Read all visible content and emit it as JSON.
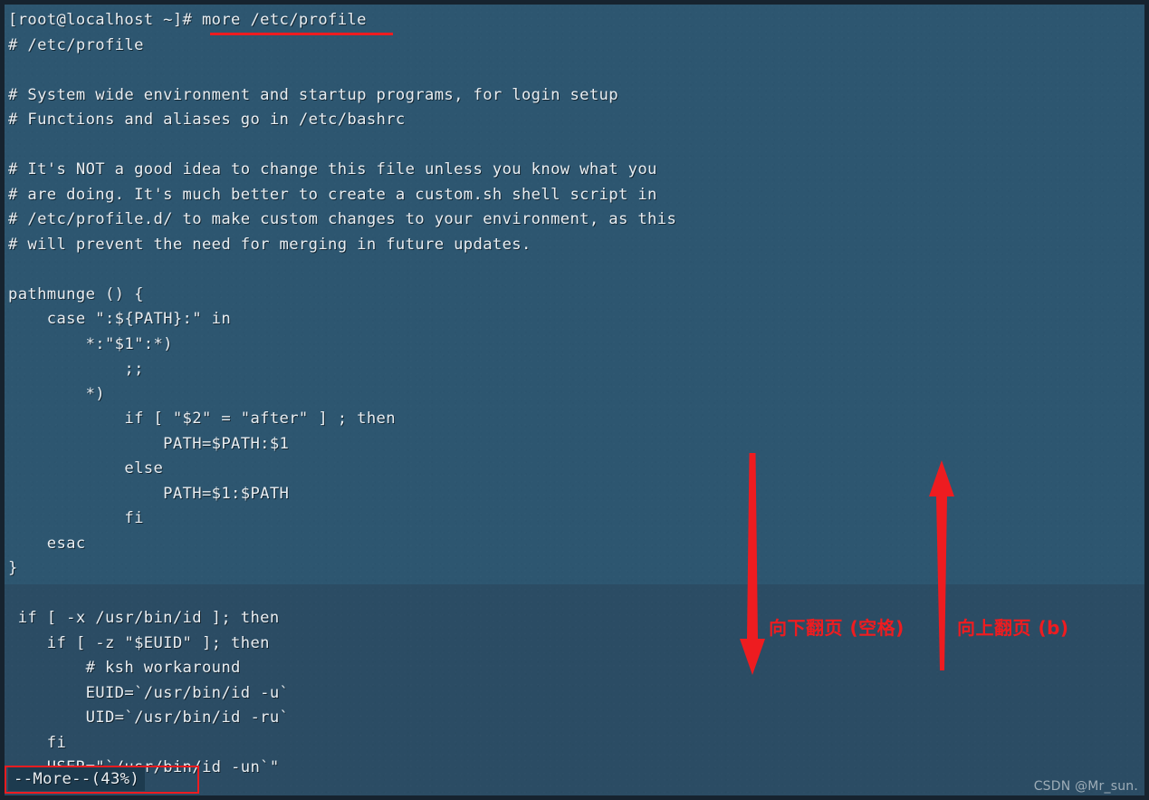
{
  "terminal": {
    "prompt_line": "[root@localhost ~]# more /etc/profile",
    "lines": [
      "[root@localhost ~]# more /etc/profile",
      "# /etc/profile",
      "",
      "# System wide environment and startup programs, for login setup",
      "# Functions and aliases go in /etc/bashrc",
      "",
      "# It's NOT a good idea to change this file unless you know what you",
      "# are doing. It's much better to create a custom.sh shell script in",
      "# /etc/profile.d/ to make custom changes to your environment, as this",
      "# will prevent the need for merging in future updates.",
      "",
      "pathmunge () {",
      "    case \":${PATH}:\" in",
      "        *:\"$1\":*)",
      "            ;;",
      "        *)",
      "            if [ \"$2\" = \"after\" ] ; then",
      "                PATH=$PATH:$1",
      "            else",
      "                PATH=$1:$PATH",
      "            fi",
      "    esac",
      "}",
      "",
      " if [ -x /usr/bin/id ]; then",
      "    if [ -z \"$EUID\" ]; then",
      "        # ksh workaround",
      "        EUID=`/usr/bin/id -u`",
      "        UID=`/usr/bin/id -ru`",
      "    fi",
      "    USER=\"`/usr/bin/id -un`\""
    ],
    "status_line": "--More--(43%)",
    "more_percent": "43%",
    "command": "more /etc/profile",
    "file_path": "/etc/profile",
    "background_color": "#2d5670",
    "background_color_lower": "#2b4c64",
    "text_color": "#e9eef2",
    "status_background_color": "#1d3b4f"
  },
  "annotations": {
    "accent_color": "#ee1c20",
    "page_down": {
      "label": "向下翻页 (空格)",
      "key": "空格",
      "arrow": "arrow-down"
    },
    "page_up": {
      "label": "向上翻页 (b)",
      "key": "b",
      "arrow": "arrow-up"
    }
  },
  "watermark": {
    "text": "CSDN @Mr_sun."
  }
}
